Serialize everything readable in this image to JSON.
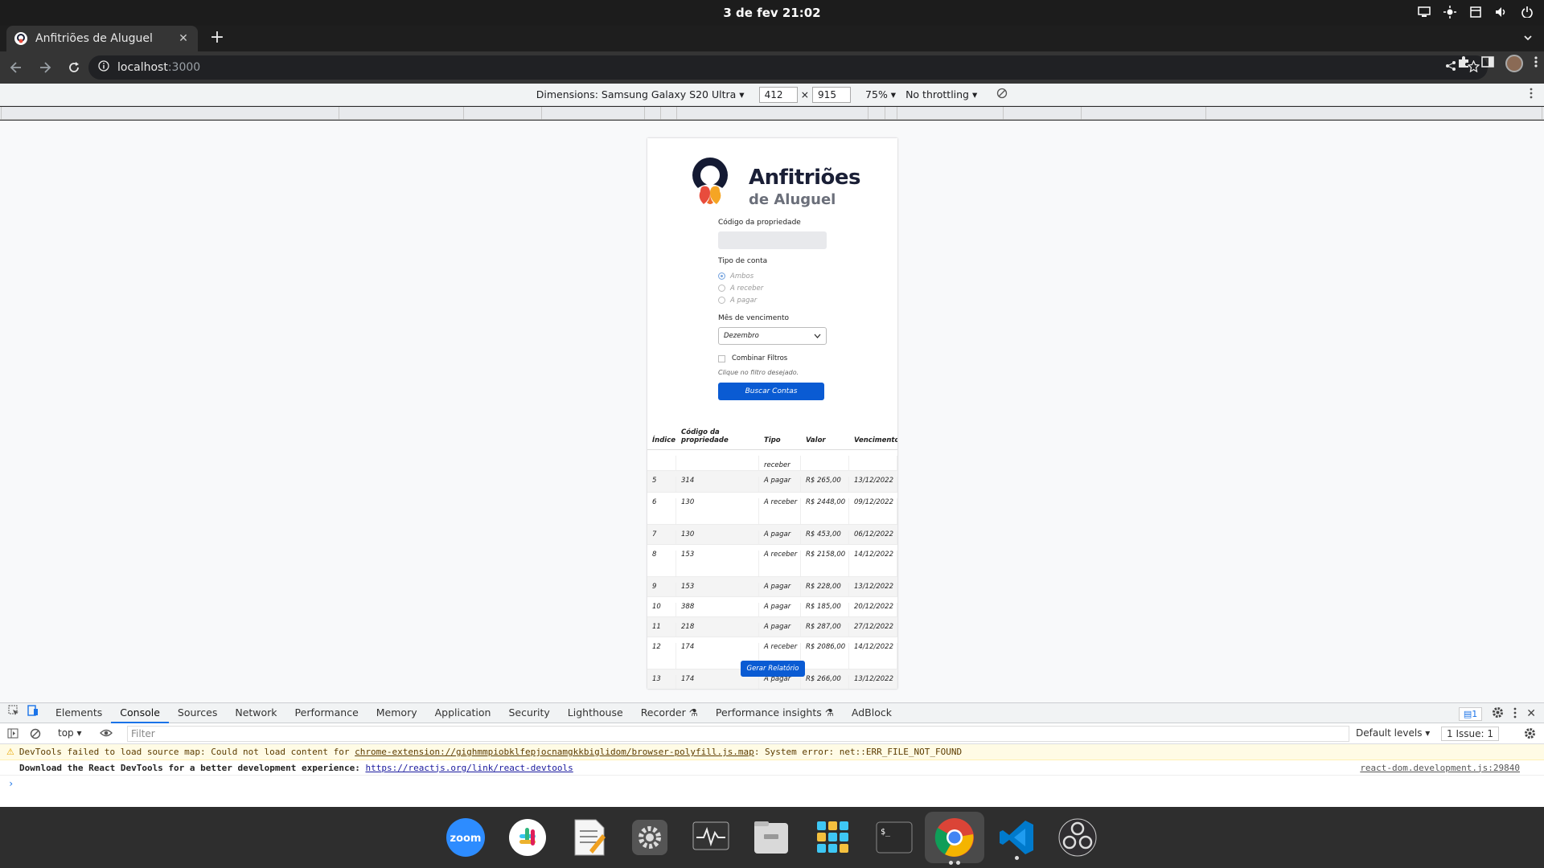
{
  "system": {
    "clock": "3 de fev  21:02"
  },
  "browser": {
    "tab_title": "Anfitriões de Aluguel",
    "url_host": "localhost",
    "url_port": ":3000"
  },
  "device_toolbar": {
    "dimensions_label": "Dimensions: Samsung Galaxy S20 Ultra ▾",
    "width": "412",
    "height": "915",
    "zoom": "75% ▾",
    "throttling": "No throttling ▾"
  },
  "app": {
    "brand_name": "Anfitriões",
    "brand_sub": "de Aluguel",
    "property_code_label": "Código da propriedade",
    "account_type_label": "Tipo de conta",
    "radio_options": [
      "Ambos",
      "A receber",
      "A pagar"
    ],
    "due_month_label": "Mês de vencimento",
    "due_month_value": "Dezembro",
    "combine_filters_label": "Combinar Filtros",
    "hint": "Clique no filtro desejado.",
    "search_button": "Buscar Contas",
    "report_button": "Gerar Relatório",
    "table_headers": [
      "Índice",
      "Código da propriedade",
      "Tipo",
      "Valor",
      "Vencimento"
    ],
    "ghost_row": {
      "tipo": "receber"
    },
    "rows": [
      {
        "indice": "5",
        "codigo": "314",
        "tipo": "A pagar",
        "valor": "R$ 265,00",
        "vencimento": "13/12/2022"
      },
      {
        "indice": "6",
        "codigo": "130",
        "tipo": "A receber",
        "valor": "R$ 2448,00",
        "vencimento": "09/12/2022"
      },
      {
        "indice": "7",
        "codigo": "130",
        "tipo": "A pagar",
        "valor": "R$ 453,00",
        "vencimento": "06/12/2022"
      },
      {
        "indice": "8",
        "codigo": "153",
        "tipo": "A receber",
        "valor": "R$ 2158,00",
        "vencimento": "14/12/2022"
      },
      {
        "indice": "9",
        "codigo": "153",
        "tipo": "A pagar",
        "valor": "R$ 228,00",
        "vencimento": "13/12/2022"
      },
      {
        "indice": "10",
        "codigo": "388",
        "tipo": "A pagar",
        "valor": "R$ 185,00",
        "vencimento": "20/12/2022"
      },
      {
        "indice": "11",
        "codigo": "218",
        "tipo": "A pagar",
        "valor": "R$ 287,00",
        "vencimento": "27/12/2022"
      },
      {
        "indice": "12",
        "codigo": "174",
        "tipo": "A receber",
        "valor": "R$ 2086,00",
        "vencimento": "14/12/2022"
      },
      {
        "indice": "13",
        "codigo": "174",
        "tipo": "A pagar",
        "valor": "R$ 266,00",
        "vencimento": "13/12/2022"
      }
    ]
  },
  "devtools": {
    "tabs": [
      "Elements",
      "Console",
      "Sources",
      "Network",
      "Performance",
      "Memory",
      "Application",
      "Security",
      "Lighthouse",
      "Recorder ⚗",
      "Performance insights ⚗",
      "AdBlock"
    ],
    "active_tab": "Console",
    "message_badge": "1",
    "context": "top ▾",
    "filter_placeholder": "Filter",
    "levels": "Default levels ▾",
    "issues": "1 Issue:  1",
    "warning_prefix": "DevTools failed to load source map: Could not load content for ",
    "warning_link": "chrome-extension://gighmmpiobklfepjocnamgkkbiglidom/browser-polyfill.js.map",
    "warning_suffix": ": System error: net::ERR_FILE_NOT_FOUND",
    "info_prefix": "Download the React DevTools for a better development experience: ",
    "info_link": "https://reactjs.org/link/react-devtools",
    "info_source": "react-dom.development.js:29840"
  },
  "dock": {
    "apps": [
      "zoom",
      "slack",
      "text-editor",
      "settings",
      "system-monitor",
      "files",
      "app-grid",
      "terminal",
      "chrome",
      "vscode",
      "obs"
    ]
  }
}
